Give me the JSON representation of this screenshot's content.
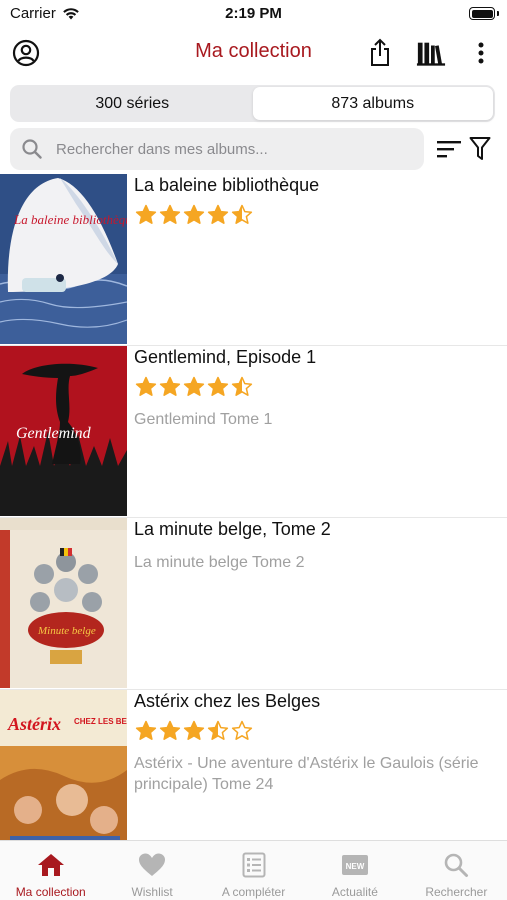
{
  "status_bar": {
    "carrier": "Carrier",
    "time": "2:19 PM"
  },
  "nav": {
    "title": "Ma collection",
    "icons": [
      "profile-icon",
      "share-icon",
      "library-icon",
      "more-vertical-icon"
    ]
  },
  "segments": [
    {
      "label": "300 séries",
      "active": false
    },
    {
      "label": "873 albums",
      "active": true
    }
  ],
  "search": {
    "placeholder": "Rechercher dans mes albums..."
  },
  "albums": [
    {
      "title": "La baleine bibliothèque",
      "rating": 4.5,
      "series": ""
    },
    {
      "title": "Gentlemind, Episode 1",
      "rating": 4.5,
      "series": "Gentlemind Tome 1"
    },
    {
      "title": "La minute belge, Tome 2",
      "rating": 0,
      "series": "La minute belge Tome 2"
    },
    {
      "title": "Astérix chez les Belges",
      "rating": 3.5,
      "series": "Astérix - Une aventure d'Astérix le Gaulois (série principale) Tome 24"
    }
  ],
  "covers": [
    {
      "title_text": "La baleine bibliothèque"
    },
    {
      "title_text": "Gentlemind"
    },
    {
      "title_text": "Minute belge"
    },
    {
      "title_text": "Astérix",
      "subtitle_text": "CHEZ LES BELGES"
    }
  ],
  "tabs": [
    {
      "label": "Ma collection",
      "icon": "home-icon",
      "active": true
    },
    {
      "label": "Wishlist",
      "icon": "heart-icon",
      "active": false
    },
    {
      "label": "A compléter",
      "icon": "checklist-icon",
      "active": false
    },
    {
      "label": "Actualité",
      "icon": "new-badge-icon",
      "active": false
    },
    {
      "label": "Rechercher",
      "icon": "search-icon",
      "active": false
    }
  ],
  "colors": {
    "accent": "#a8191f",
    "star": "#f5a623",
    "inactive": "#9a9a9a",
    "tab_icon_inactive": "#b5b5b5"
  }
}
